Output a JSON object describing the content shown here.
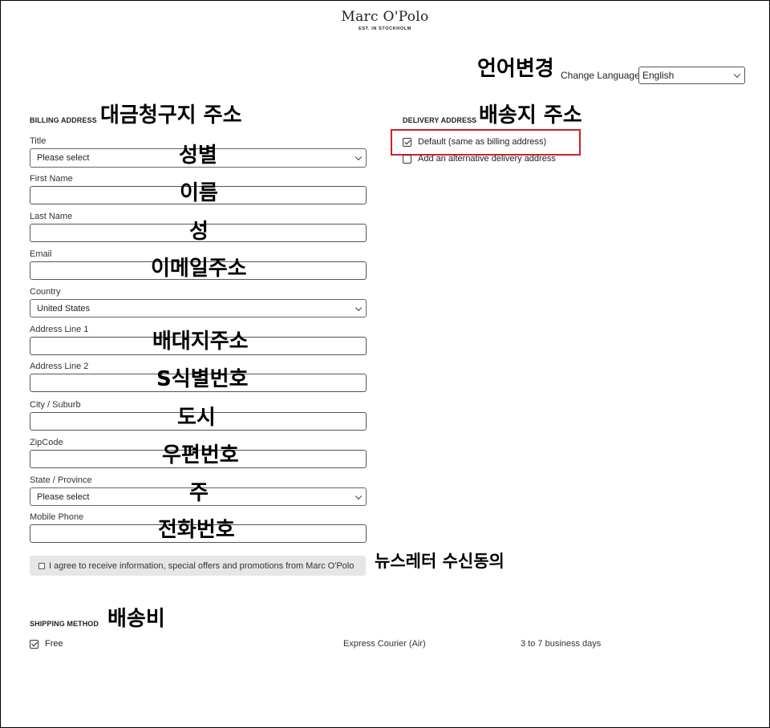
{
  "header": {
    "brand": "Marc O'Polo",
    "tagline": "EST. IN STOCKHOLM"
  },
  "language": {
    "annotation": "언어변경",
    "label": "Change Language",
    "selected": "English"
  },
  "billing": {
    "title": "BILLING ADDRESS",
    "annotation": "대금청구지 주소",
    "fields": [
      {
        "label": "Title",
        "value": "Please select",
        "type": "select",
        "annotation": "성별"
      },
      {
        "label": "First Name",
        "value": "",
        "type": "text",
        "annotation": "이름"
      },
      {
        "label": "Last Name",
        "value": "",
        "type": "text",
        "annotation": "성"
      },
      {
        "label": "Email",
        "value": "",
        "type": "text",
        "annotation": "이메일주소"
      },
      {
        "label": "Country",
        "value": "United States",
        "type": "select",
        "annotation": ""
      },
      {
        "label": "Address Line 1",
        "value": "",
        "type": "text",
        "annotation": "배대지주소"
      },
      {
        "label": "Address Line 2",
        "value": "",
        "type": "text",
        "annotation": "S식별번호"
      },
      {
        "label": "City / Suburb",
        "value": "",
        "type": "text",
        "annotation": "도시"
      },
      {
        "label": "ZipCode",
        "value": "",
        "type": "text",
        "annotation": "우편번호"
      },
      {
        "label": "State / Province",
        "value": "Please select",
        "type": "select",
        "annotation": "주"
      },
      {
        "label": "Mobile Phone",
        "value": "",
        "type": "text",
        "annotation": "전화번호"
      }
    ]
  },
  "delivery": {
    "title": "DELIVERY ADDRESS",
    "annotation": "배송지 주소",
    "option_default": "Default (same as billing address)",
    "option_default_checked": true,
    "option_alternative": "Add an alternative delivery address",
    "option_alternative_checked": false,
    "highlight_color": "#d0202a"
  },
  "newsletter": {
    "label": "I agree to receive information, special offers and promotions from Marc O'Polo",
    "annotation": "뉴스레터 수신동의",
    "checked": false
  },
  "shipping": {
    "title": "SHIPPING METHOD",
    "annotation": "배송비",
    "option_label": "Free",
    "option_checked": true,
    "carrier": "Express Courier (Air)",
    "eta": "3 to 7 business days"
  }
}
